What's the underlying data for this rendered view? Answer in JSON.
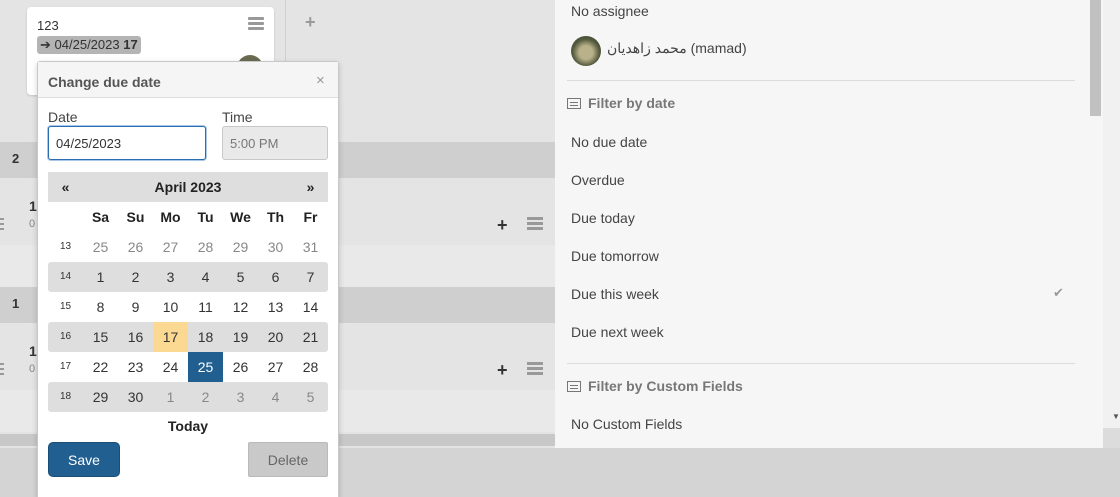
{
  "board": {
    "card": {
      "title": "123",
      "due_date": "04/25/2023",
      "due_day": "17"
    },
    "swimlane_1_label": "2",
    "swimlane_2_label": "1",
    "lane_card_1_num": "1",
    "lane_card_1_sub": "0",
    "lane_card_2_num": "1",
    "lane_card_2_sub": "0",
    "add_list_glyph": "+",
    "add_card_glyph": "+"
  },
  "sidebar": {
    "no_assignee": "No assignee",
    "member_name": "محمد زاهدیان (mamad)",
    "filter_date_heading": "Filter by date",
    "date_options": [
      "No due date",
      "Overdue",
      "Due today",
      "Due tomorrow",
      "Due this week",
      "Due next week"
    ],
    "selected_option_check": "✔",
    "filter_custom_heading": "Filter by Custom Fields",
    "no_custom_fields": "No Custom Fields"
  },
  "popup": {
    "title": "Change due date",
    "close": "×",
    "date_label": "Date",
    "date_value": "04/25/2023",
    "time_label": "Time",
    "time_value": "5:00 PM",
    "prev": "«",
    "next": "»",
    "month": "April 2023",
    "weekdays": [
      "Sa",
      "Su",
      "Mo",
      "Tu",
      "We",
      "Th",
      "Fr"
    ],
    "weeks": [
      {
        "wk": "13",
        "days": [
          "25",
          "26",
          "27",
          "28",
          "29",
          "30",
          "31"
        ]
      },
      {
        "wk": "14",
        "days": [
          "1",
          "2",
          "3",
          "4",
          "5",
          "6",
          "7"
        ]
      },
      {
        "wk": "15",
        "days": [
          "8",
          "9",
          "10",
          "11",
          "12",
          "13",
          "14"
        ]
      },
      {
        "wk": "16",
        "days": [
          "15",
          "16",
          "17",
          "18",
          "19",
          "20",
          "21"
        ]
      },
      {
        "wk": "17",
        "days": [
          "22",
          "23",
          "24",
          "25",
          "26",
          "27",
          "28"
        ]
      },
      {
        "wk": "18",
        "days": [
          "29",
          "30",
          "1",
          "2",
          "3",
          "4",
          "5"
        ]
      }
    ],
    "today_label": "Today",
    "save_label": "Save",
    "delete_label": "Delete"
  },
  "colors": {
    "accent": "#215f91",
    "today": "#fcd993",
    "cell_gray": "#dedede"
  }
}
